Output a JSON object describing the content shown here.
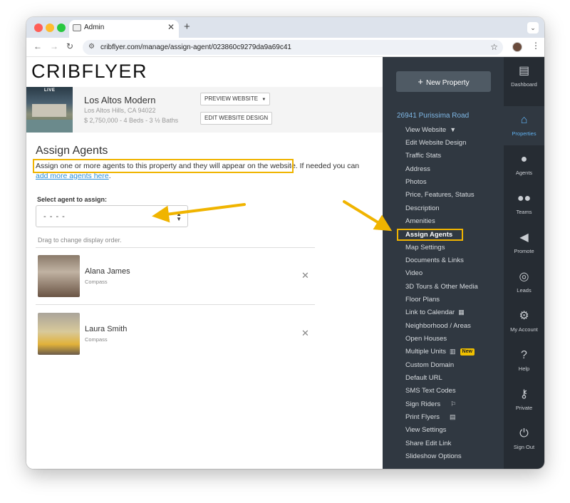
{
  "browser": {
    "tab_title": "Admin",
    "url": "cribflyer.com/manage/assign-agent/023860c9279da9a69c41"
  },
  "app": {
    "logo": "CRIBFLYER"
  },
  "property": {
    "live_badge": "LIVE",
    "name": "Los Altos Modern",
    "location": "Los Altos Hills, CA 94022",
    "summary": "$ 2,750,000 - 4 Beds - 3 ½ Baths",
    "preview_button": "PREVIEW WEBSITE",
    "edit_design_button": "EDIT WEBSITE DESIGN"
  },
  "assign": {
    "title": "Assign Agents",
    "desc_main": "Assign one or more agents to this property and they will appear on the website.",
    "desc_tail": " If needed you can ",
    "desc_link": "add more agents here",
    "desc_end": ".",
    "select_label": "Select agent to assign:",
    "select_value": "- - - -",
    "drag_hint": "Drag to change display order."
  },
  "agents": [
    {
      "name": "Alana James",
      "company": "Compass"
    },
    {
      "name": "Laura Smith",
      "company": "Compass"
    }
  ],
  "sidebar": {
    "new_property": "New Property",
    "address": "26941 Purissima Road",
    "items": [
      "View Website",
      "Edit Website Design",
      "Traffic Stats",
      "Address",
      "Photos",
      "Price, Features, Status",
      "Description",
      "Amenities",
      "Assign Agents",
      "Map Settings",
      "Documents & Links",
      "Video",
      "3D Tours & Other Media",
      "Floor Plans",
      "Link to Calendar",
      "Neighborhood / Areas",
      "Open Houses",
      "Multiple Units",
      "Custom Domain",
      "Default URL",
      "SMS Text Codes",
      "Sign Riders",
      "Print Flyers",
      "View Settings",
      "Share Edit Link",
      "Slideshow Options"
    ],
    "new_badge": "New"
  },
  "rail": [
    {
      "label": "Dashboard",
      "icon": "dashboard-icon"
    },
    {
      "label": "Properties",
      "icon": "properties-icon"
    },
    {
      "label": "Agents",
      "icon": "agents-icon"
    },
    {
      "label": "Teams",
      "icon": "teams-icon"
    },
    {
      "label": "Promote",
      "icon": "megaphone-icon"
    },
    {
      "label": "Leads",
      "icon": "target-icon"
    },
    {
      "label": "My Account",
      "icon": "gear-icon"
    },
    {
      "label": "Help",
      "icon": "help-icon"
    },
    {
      "label": "Private",
      "icon": "key-icon"
    },
    {
      "label": "Sign Out",
      "icon": "power-icon"
    }
  ],
  "colors": {
    "highlight": "#f0b400",
    "sidebar_bg": "#303841",
    "rail_bg": "#262c33",
    "link": "#2b8fd8",
    "active_rail": "#5fb0ef"
  }
}
